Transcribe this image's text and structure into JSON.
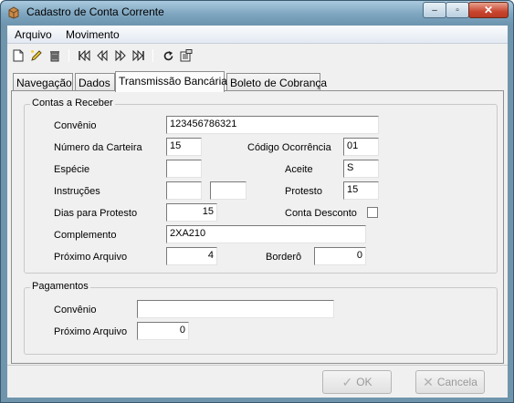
{
  "window": {
    "title": "Cadastro de Conta Corrente",
    "buttons": {
      "minimize": "–",
      "maximize": "▫",
      "close": "✕"
    }
  },
  "menu": [
    "Arquivo",
    "Movimento"
  ],
  "toolbar": {
    "icons": [
      "new-document-icon",
      "edit-pencil-icon",
      "delete-trash-icon",
      "first-record-icon",
      "prior-record-icon",
      "next-record-icon",
      "last-record-icon",
      "refresh-icon",
      "properties-icon"
    ]
  },
  "tabs": [
    {
      "label": "Navegação",
      "active": false
    },
    {
      "label": "Dados",
      "active": false
    },
    {
      "label": "Transmissão Bancária",
      "active": true
    },
    {
      "label": "Boleto de Cobrança",
      "active": false
    }
  ],
  "contas_receber": {
    "title": "Contas a Receber",
    "convenio": {
      "label": "Convênio",
      "value": "123456786321"
    },
    "numero_carteira": {
      "label": "Número da Carteira",
      "value": "15"
    },
    "codigo_ocorrencia": {
      "label": "Código Ocorrência",
      "value": "01"
    },
    "especie": {
      "label": "Espécie",
      "value": ""
    },
    "aceite": {
      "label": "Aceite",
      "value": "S"
    },
    "instrucoes": {
      "label": "Instruções",
      "value1": "",
      "value2": ""
    },
    "protesto": {
      "label": "Protesto",
      "value": "15"
    },
    "dias_protesto": {
      "label": "Dias para Protesto",
      "value": "15"
    },
    "conta_desconto": {
      "label": "Conta Desconto",
      "checked": false
    },
    "complemento": {
      "label": "Complemento",
      "value": "2XA210"
    },
    "proximo_arquivo": {
      "label": "Próximo Arquivo",
      "value": "4"
    },
    "bordero": {
      "label": "Borderô",
      "value": "0"
    }
  },
  "pagamentos": {
    "title": "Pagamentos",
    "convenio": {
      "label": "Convênio",
      "value": ""
    },
    "proximo_arquivo": {
      "label": "Próximo Arquivo",
      "value": "0"
    }
  },
  "buttons": {
    "ok": "OK",
    "cancel": "Cancela"
  },
  "colors": {
    "title_bar": "#7fa6c0",
    "close_button": "#c94630",
    "panel": "#f0f0f0"
  }
}
